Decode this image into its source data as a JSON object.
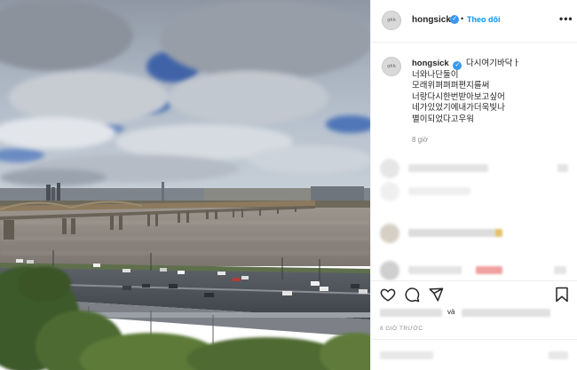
{
  "header": {
    "username": "hongsick",
    "follow_label": "Theo dõi",
    "separator": "•",
    "more_label": "•••",
    "avatar_text": "ᵍʰᵏ"
  },
  "caption": {
    "username": "hongsick",
    "lines": [
      "다시여기바닥ㅏ",
      "너와나단둘이",
      "모래위펴펴펴편지를써",
      "너랑다시한번받아보고싶어",
      "네가있었기에내가더욱빛나",
      "별이되었다고우워"
    ],
    "time_ago": "8 giờ"
  },
  "likes": {
    "connector": "và"
  },
  "posted_ago": "8 GIỜ TRƯỚC",
  "icons": {
    "verified": "verified-badge-icon",
    "more": "more-options-icon",
    "like": "heart-icon",
    "comment": "comment-bubble-icon",
    "share": "paper-plane-icon",
    "save": "bookmark-icon"
  },
  "colors": {
    "accent": "#0095f6",
    "verified": "#3897f0",
    "muted": "#8e8e8e",
    "text": "#262626"
  }
}
